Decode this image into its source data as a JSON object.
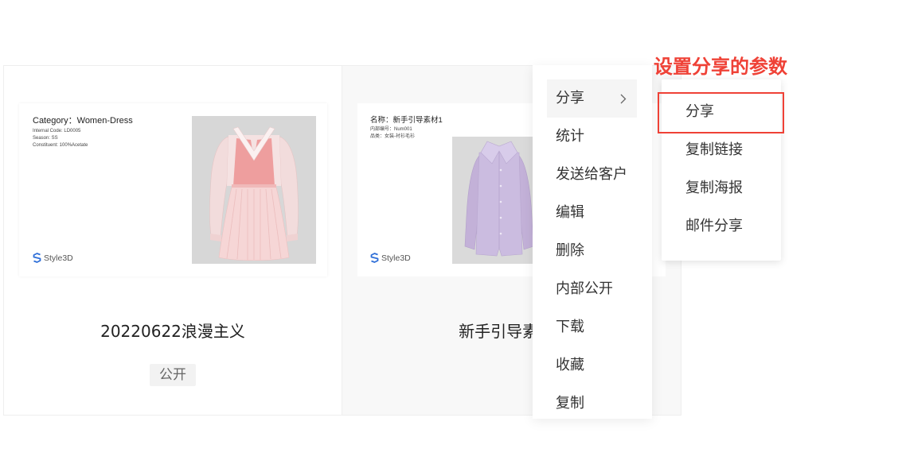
{
  "annotation": {
    "title": "设置分享的参数",
    "color": "#ef4136"
  },
  "cards": [
    {
      "title": "20220622浪漫主义",
      "badge": "公开",
      "preview": {
        "heading": "Category：Women-Dress",
        "lines": [
          "Internal Code:  LD0005",
          "Season:  SS",
          "Constituent:  100%Acetate"
        ],
        "brand": "Style3D",
        "garment_icon": "dress-illustration"
      }
    },
    {
      "title": "新手引导素材1",
      "preview": {
        "heading": "名称：新手引导素材1",
        "lines": [
          "内部编号：Num001",
          "品类：女装-衬衫毛衫"
        ],
        "brand": "Style3D",
        "garment_icon": "shirt-illustration"
      }
    }
  ],
  "menu": {
    "items": [
      {
        "label": "分享",
        "active": true,
        "submenu_icon": "chevron-right-icon"
      },
      {
        "label": "统计"
      },
      {
        "label": "发送给客户"
      },
      {
        "label": "编辑"
      },
      {
        "label": "删除"
      },
      {
        "label": "内部公开"
      },
      {
        "label": "下载"
      },
      {
        "label": "收藏"
      },
      {
        "label": "复制"
      }
    ]
  },
  "submenu": {
    "items": [
      {
        "label": "分享",
        "highlighted": true
      },
      {
        "label": "复制链接"
      },
      {
        "label": "复制海报"
      },
      {
        "label": "邮件分享"
      }
    ]
  },
  "colors": {
    "accent_red": "#ef4136",
    "menu_hover": "#f5f5f5",
    "badge_bg": "#f2f2f2",
    "card_hover_bg": "#f8f8f8",
    "brand_blue": "#2f6fd8",
    "dress_pink": "#ee9e9e",
    "shirt_lavender": "#cbbce0"
  }
}
